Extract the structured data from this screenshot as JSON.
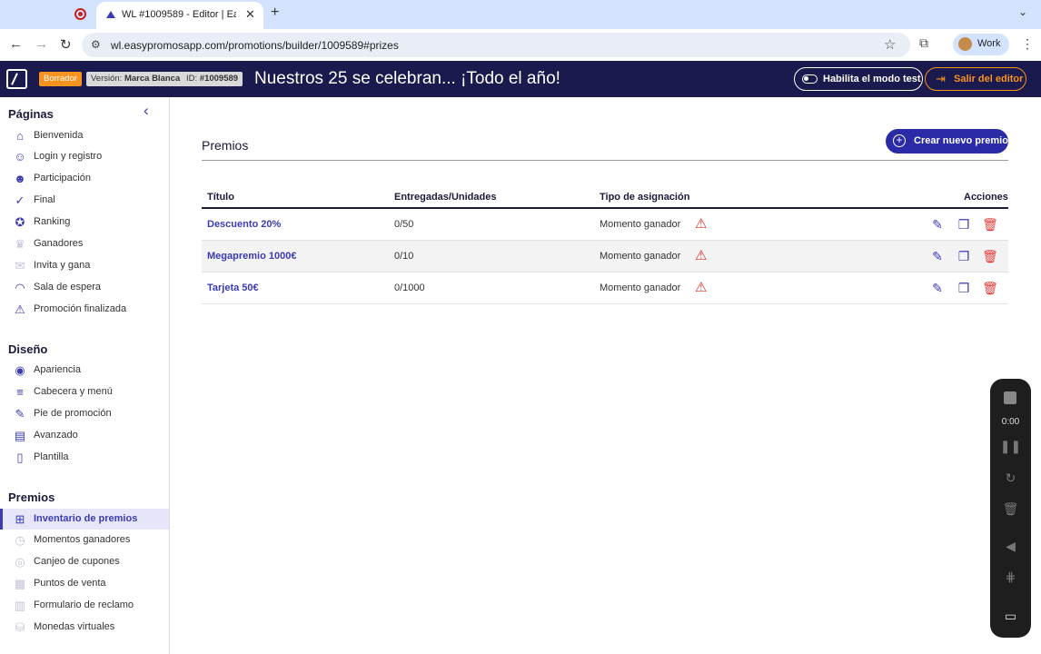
{
  "browser": {
    "tab_title": "WL #1009589 - Editor | Easy",
    "url": "wl.easypromosapp.com/promotions/builder/1009589#prizes",
    "profile_label": "Work"
  },
  "header": {
    "status_badge": "Borrador",
    "version_label": "Versión:",
    "version_value": "Marca Blanca",
    "id_label": "ID:",
    "id_value": "#1009589",
    "promo_title": "Nuestros 25 se celebran... ¡Todo el año!",
    "test_mode_label": "Habilita el modo test",
    "exit_label": "Salir del editor"
  },
  "sidebar": {
    "sections": [
      {
        "title": "Páginas",
        "items": [
          {
            "label": "Bienvenida",
            "icon": "home-icon"
          },
          {
            "label": "Login y registro",
            "icon": "user-icon"
          },
          {
            "label": "Participación",
            "icon": "users-icon"
          },
          {
            "label": "Final",
            "icon": "check-icon"
          },
          {
            "label": "Ranking",
            "icon": "medal-icon"
          },
          {
            "label": "Ganadores",
            "icon": "trophy-icon"
          },
          {
            "label": "Invita y gana",
            "icon": "gift-icon"
          },
          {
            "label": "Sala de espera",
            "icon": "speedometer-icon"
          },
          {
            "label": "Promoción finalizada",
            "icon": "warning-icon"
          }
        ]
      },
      {
        "title": "Diseño",
        "items": [
          {
            "label": "Apariencia",
            "icon": "palette-icon"
          },
          {
            "label": "Cabecera y menú",
            "icon": "menu-icon"
          },
          {
            "label": "Pie de promoción",
            "icon": "pencil-icon"
          },
          {
            "label": "Avanzado",
            "icon": "code-file-icon"
          },
          {
            "label": "Plantilla",
            "icon": "file-icon"
          }
        ]
      },
      {
        "title": "Premios",
        "items": [
          {
            "label": "Inventario de premios",
            "icon": "gift-box-icon"
          },
          {
            "label": "Momentos ganadores",
            "icon": "clock-icon"
          },
          {
            "label": "Canjeo de cupones",
            "icon": "ticket-icon"
          },
          {
            "label": "Puntos de venta",
            "icon": "store-icon"
          },
          {
            "label": "Formulario de reclamo",
            "icon": "form-icon"
          },
          {
            "label": "Monedas virtuales",
            "icon": "coins-icon"
          }
        ]
      }
    ]
  },
  "main": {
    "title": "Premios",
    "new_prize_label": "Crear nuevo premio",
    "columns": [
      "Título",
      "Entregadas/Unidades",
      "Tipo de asignación",
      "Acciones"
    ],
    "rows": [
      {
        "title": "Descuento 20%",
        "units": "0/50",
        "type": "Momento ganador"
      },
      {
        "title": "Megapremio 1000€",
        "units": "0/10",
        "type": "Momento ganador"
      },
      {
        "title": "Tarjeta 50€",
        "units": "0/1000",
        "type": "Momento ganador"
      }
    ]
  },
  "recorder": {
    "time": "0:00"
  },
  "colors": {
    "header_bg": "#1a1a4e",
    "accent": "#3b3bb3",
    "draft_badge": "#f7931e",
    "delete": "#e53935"
  }
}
